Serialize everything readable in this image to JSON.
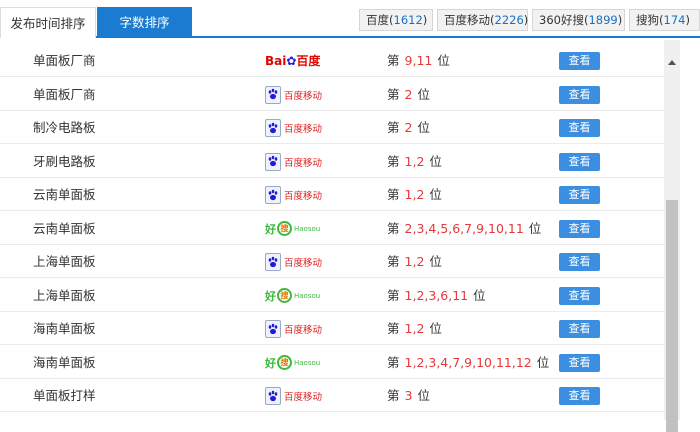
{
  "tabs": {
    "publish_time": "发布时间排序",
    "word_count": "字数排序"
  },
  "engines": [
    {
      "name": "百度",
      "count": "1612"
    },
    {
      "name": "百度移动",
      "count": "2226"
    },
    {
      "name": "360好搜",
      "count": "1899"
    },
    {
      "name": "搜狗",
      "count": "174"
    }
  ],
  "rank_prefix": "第",
  "rank_suffix": "位",
  "view_label": "查看",
  "logos": {
    "baidu": {
      "part1": "Bai",
      "paw": "✿",
      "part2": "百度"
    },
    "baidu_mobile": {
      "text": "百度移动"
    },
    "haosou": {
      "hao": "好",
      "sou": "搜",
      "en": "Haosou"
    }
  },
  "rows": [
    {
      "keyword": "单面板厂商",
      "engine": "baidu",
      "rank": "9,11"
    },
    {
      "keyword": "单面板厂商",
      "engine": "baidu_mobile",
      "rank": "2"
    },
    {
      "keyword": "制冷电路板",
      "engine": "baidu_mobile",
      "rank": "2"
    },
    {
      "keyword": "牙刷电路板",
      "engine": "baidu_mobile",
      "rank": "1,2"
    },
    {
      "keyword": "云南单面板",
      "engine": "baidu_mobile",
      "rank": "1,2"
    },
    {
      "keyword": "云南单面板",
      "engine": "haosou",
      "rank": "2,3,4,5,6,7,9,10,11"
    },
    {
      "keyword": "上海单面板",
      "engine": "baidu_mobile",
      "rank": "1,2"
    },
    {
      "keyword": "上海单面板",
      "engine": "haosou",
      "rank": "1,2,3,6,11"
    },
    {
      "keyword": "海南单面板",
      "engine": "baidu_mobile",
      "rank": "1,2"
    },
    {
      "keyword": "海南单面板",
      "engine": "haosou",
      "rank": "1,2,3,4,7,9,10,11,12"
    },
    {
      "keyword": "单面板打样",
      "engine": "baidu_mobile",
      "rank": "3"
    }
  ]
}
